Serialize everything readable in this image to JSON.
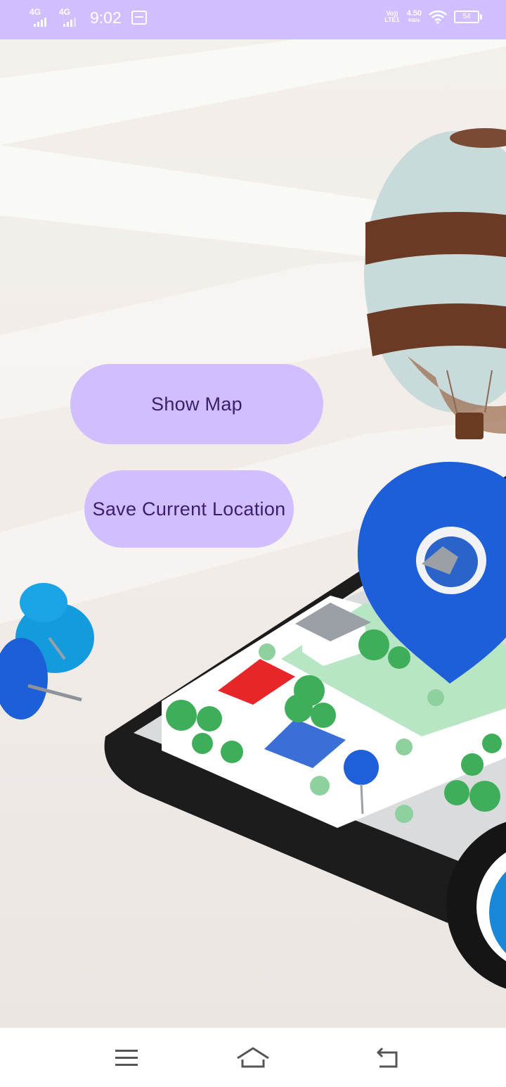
{
  "status_bar": {
    "network_1": "4G",
    "network_2": "4G",
    "time": "9:02",
    "volte_top": "Vo))",
    "volte_bottom": "LTE1",
    "speed_value": "4.50",
    "speed_unit": "KB/s",
    "battery": "54"
  },
  "main": {
    "show_map_label": "Show Map",
    "save_location_label": "Save Current Location"
  },
  "nav_bar": {
    "icons": [
      "menu-icon",
      "home-icon",
      "back-icon"
    ]
  },
  "colors": {
    "accent": "#d1beff",
    "button_text": "#3b1f6c",
    "pin_blue": "#1e5fd8"
  }
}
